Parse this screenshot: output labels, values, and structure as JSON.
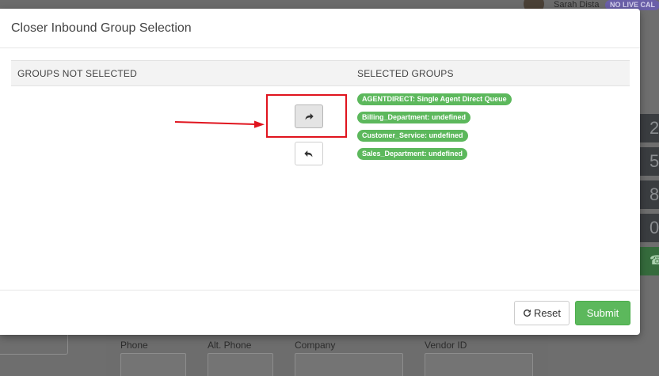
{
  "background": {
    "user_name": "Sarah Dista",
    "status_badge": "NO LIVE CAL",
    "dial_keys": [
      "2",
      "5",
      "8",
      "0"
    ],
    "fields": [
      "Phone",
      "Alt. Phone",
      "Company",
      "Vendor ID"
    ]
  },
  "modal": {
    "title": "Closer Inbound Group Selection",
    "columns": {
      "not_selected": "GROUPS NOT SELECTED",
      "selected": "SELECTED GROUPS"
    },
    "not_selected_groups": [],
    "selected_groups": [
      "AGENTDIRECT: Single Agent Direct Queue",
      "Billing_Department: undefined",
      "Customer_Service: undefined",
      "Sales_Department: undefined"
    ],
    "buttons": {
      "move_right": "move-selected-right",
      "move_left": "move-selected-left",
      "reset_label": "Reset",
      "submit_label": "Submit"
    }
  },
  "annotation": {
    "highlight_color": "#e0141e"
  },
  "colors": {
    "accent_green": "#5cb85c",
    "badge_purple": "#6a5fa8"
  }
}
